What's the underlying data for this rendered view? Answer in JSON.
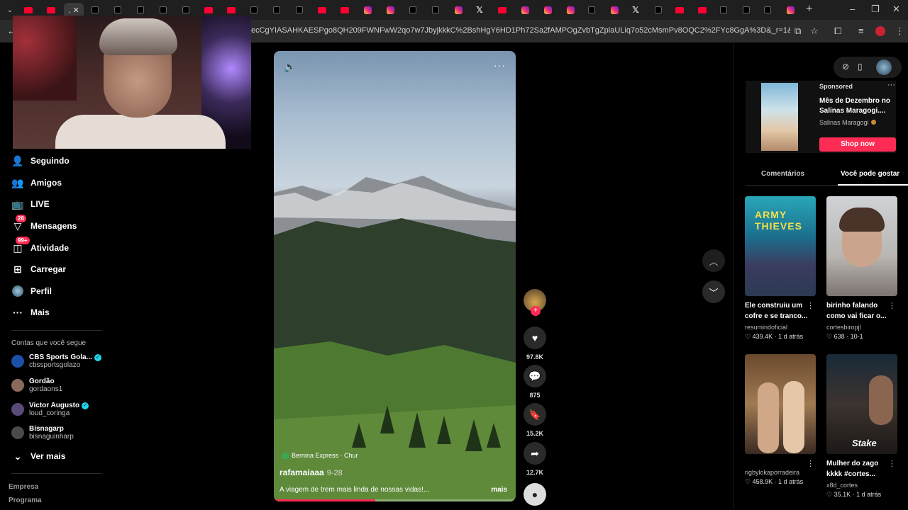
{
  "browser": {
    "tabs": [
      "yt",
      "yt",
      "active",
      "tt",
      "tt",
      "tt",
      "tt",
      "yt",
      "yt",
      "tt",
      "tt",
      "tt",
      "yt",
      "yt",
      "ig",
      "ig",
      "tt",
      "tt",
      "ig",
      "x",
      "yt",
      "ig",
      "ig",
      "ig",
      "tt",
      "ig",
      "x",
      "tt",
      "yt",
      "yt",
      "tt",
      "tt",
      "tt",
      "ig"
    ],
    "active_tab_label": ". ✕",
    "url": "ecCgYIASAHKAESPgo8QH209FWNFwW2qo7w7JbyjkkkC%2BshHgY6HD1Ph72Sa2fAMPOgZvbTgZplaULiq7o52cMsmPv8OQC2%2FYc8GgA%3D&_r=1&_svg=1&checksum=1cd680713d..."
  },
  "sidebar": {
    "nav": [
      {
        "label": "Seguindo",
        "icon": "following-icon"
      },
      {
        "label": "Amigos",
        "icon": "friends-icon"
      },
      {
        "label": "LIVE",
        "icon": "live-icon"
      },
      {
        "label": "Mensagens",
        "icon": "messages-icon",
        "badge": "26"
      },
      {
        "label": "Atividade",
        "icon": "activity-icon",
        "badge": "99+"
      },
      {
        "label": "Carregar",
        "icon": "upload-icon"
      },
      {
        "label": "Perfil",
        "icon": "profile-icon"
      },
      {
        "label": "Mais",
        "icon": "more-icon"
      }
    ],
    "following_title": "Contas que você segue",
    "accounts": [
      {
        "name": "CBS Sports Gola...",
        "handle": "cbssportsgolazo",
        "verified": true,
        "color": "#1c4fa8"
      },
      {
        "name": "Gordão",
        "handle": "gordaons1",
        "verified": false,
        "color": "#8a6a5a"
      },
      {
        "name": "Victor Augusto",
        "handle": "loud_coringa",
        "verified": true,
        "color": "#5a4a78"
      },
      {
        "name": "Bisnagarp",
        "handle": "bisnaguinharp",
        "verified": false,
        "color": "#4a4a4a"
      }
    ],
    "see_more": "Ver mais",
    "footer": [
      "Empresa",
      "Programa"
    ]
  },
  "video": {
    "location": "Bernina Express · Chur",
    "author": "rafamaiaaa",
    "date": "9-28",
    "caption": "A viagem de trem mais linda de nossas vidas!...",
    "caption_more": "mais",
    "progress": 0.42
  },
  "actions": {
    "likes": "97.8K",
    "comments": "875",
    "saves": "15.2K",
    "shares": "12.7K"
  },
  "right_panel": {
    "ad": {
      "sponsored": "Sponsored",
      "title": "Mês de Dezembro no Salinas Maragogi....",
      "brand": "Salinas Maragogi",
      "cta": "Shop now"
    },
    "tabs": [
      "Comentários",
      "Você pode gostar"
    ],
    "cards": [
      {
        "title": "Ele construiu um cofre e se tranco...",
        "user": "resumindoficial",
        "likes": "439.4K",
        "age": "1 d atrás",
        "thumb_text": "ARMY THIEVES"
      },
      {
        "title": "birinho falando como vai ficar o...",
        "user": "cortesbiropjl",
        "likes": "638",
        "age": "10-1",
        "thumb_text": ""
      },
      {
        "title": "",
        "user": "rigbylokaporradeira",
        "likes": "458.9K",
        "age": "1 d atrás",
        "thumb_text": ""
      },
      {
        "title": "Mulher do zago kkkk #cortes...",
        "user": "x8d_cortes",
        "likes": "35.1K",
        "age": "1 d atrás",
        "thumb_text": "Stake"
      }
    ]
  },
  "colors": {
    "accent": "#fe2c55",
    "verified": "#20d5ec"
  }
}
